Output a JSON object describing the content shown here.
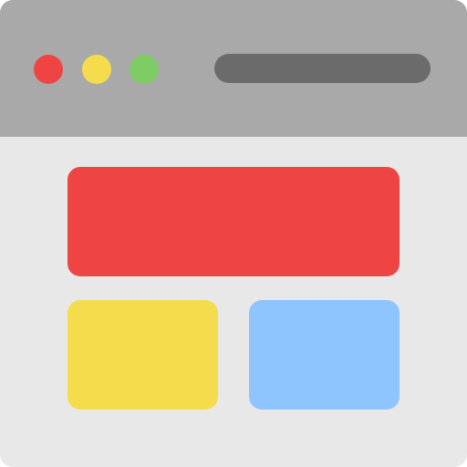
{
  "icon": "browser-window-icon",
  "colors": {
    "titlebar": "#a9a9a9",
    "body": "#e8e8e8",
    "dot_close": "#ef4444",
    "dot_minimize": "#f5dc4c",
    "dot_maximize": "#7fcc66",
    "address_bar": "#6b6b6b",
    "block_hero": "#ef4444",
    "block_left": "#f5dc4c",
    "block_right": "#8ec5ff"
  }
}
